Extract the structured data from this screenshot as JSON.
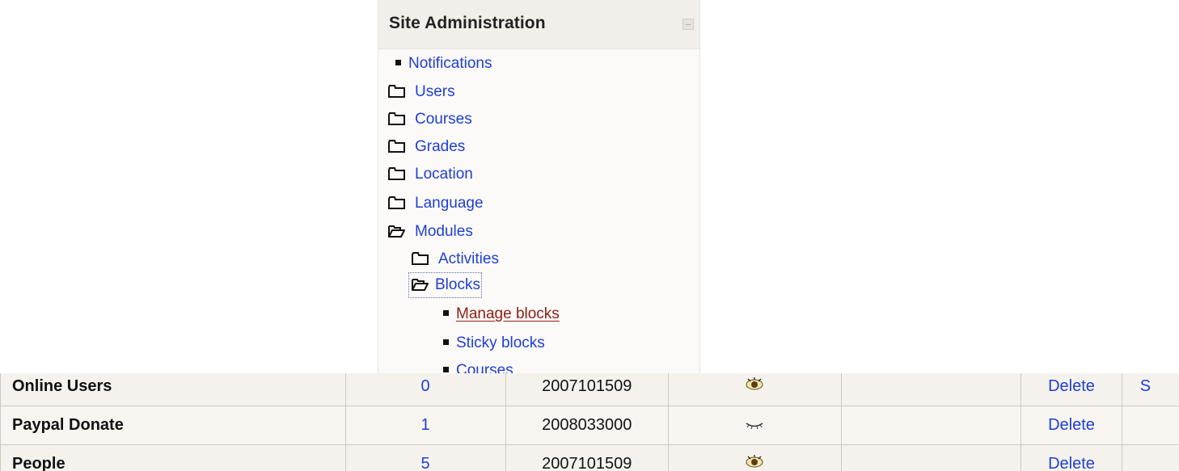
{
  "admin_block": {
    "title": "Site Administration",
    "items": [
      {
        "label": "Notifications",
        "type": "page"
      },
      {
        "label": "Users",
        "type": "folder-closed"
      },
      {
        "label": "Courses",
        "type": "folder-closed"
      },
      {
        "label": "Grades",
        "type": "folder-closed"
      },
      {
        "label": "Location",
        "type": "folder-closed"
      },
      {
        "label": "Language",
        "type": "folder-closed"
      },
      {
        "label": "Modules",
        "type": "folder-open"
      },
      {
        "label": "Activities",
        "type": "folder-closed"
      },
      {
        "label": "Blocks",
        "type": "folder-open"
      },
      {
        "label": "Manage blocks",
        "type": "page",
        "active": true
      },
      {
        "label": "Sticky blocks",
        "type": "page"
      },
      {
        "label": "Courses",
        "type": "page"
      }
    ]
  },
  "table": {
    "rows": [
      {
        "name": "Online Users",
        "instances": "0",
        "version": "2007101509",
        "hide_icon": "eye-open-icon",
        "delete_label": "Delete",
        "extra": "S"
      },
      {
        "name": "Paypal Donate",
        "instances": "1",
        "version": "2008033000",
        "hide_icon": "eye-closed-icon",
        "delete_label": "Delete",
        "extra": ""
      },
      {
        "name": "People",
        "instances": "5",
        "version": "2007101509",
        "hide_icon": "eye-open-icon",
        "delete_label": "Delete",
        "extra": ""
      }
    ]
  },
  "colors": {
    "link": "#1d3fd4",
    "active_link": "#8b1e12",
    "header_bg": "#f2efea",
    "block_bg": "#fcfaf8",
    "table_bg": "#f5f2ee",
    "table_border": "#ccc9c4"
  }
}
